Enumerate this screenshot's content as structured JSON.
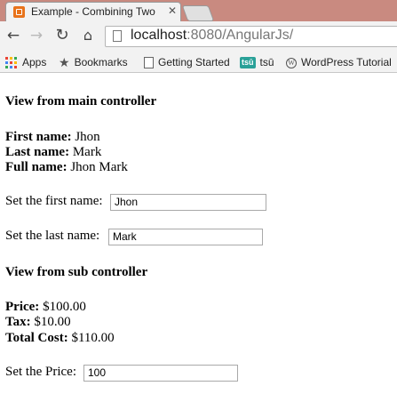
{
  "browser": {
    "tab_title": "Example - Combining Two",
    "tab_close": "✕",
    "url_host": "localhost",
    "url_rest": ":8080/AngularJs/",
    "bookmarks": [
      {
        "label": "Apps",
        "icon": "apps-grid-icon"
      },
      {
        "label": "Bookmarks",
        "icon": "star-icon"
      },
      {
        "label": "Getting Started",
        "icon": "page-icon"
      },
      {
        "label": "tsū",
        "icon": "tsu-icon",
        "icon_text": "tsū"
      },
      {
        "label": "WordPress Tutorial",
        "icon": "wordpress-icon",
        "icon_text": "W"
      }
    ]
  },
  "main_view": {
    "heading": "View from main controller",
    "first_name_label": "First name:",
    "first_name_value": "Jhon",
    "last_name_label": "Last name:",
    "last_name_value": "Mark",
    "full_name_label": "Full name:",
    "full_name_value": "Jhon Mark",
    "set_first_label": "Set the first name:",
    "first_input_value": "Jhon",
    "set_last_label": "Set the last name:",
    "last_input_value": "Mark"
  },
  "sub_view": {
    "heading": "View from sub controller",
    "price_label": "Price:",
    "price_value": "$100.00",
    "tax_label": "Tax:",
    "tax_value": "$10.00",
    "total_label": "Total Cost:",
    "total_value": "$110.00",
    "set_price_label": "Set the Price:",
    "price_input_value": "100"
  }
}
